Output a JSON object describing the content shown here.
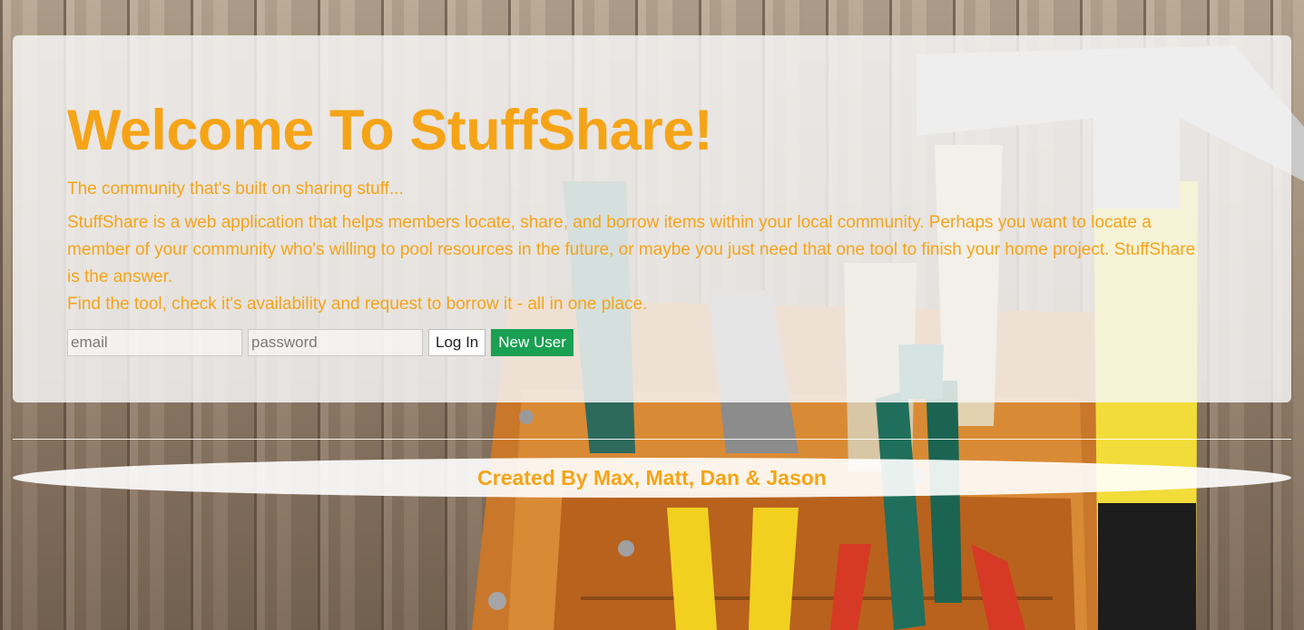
{
  "jumbotron": {
    "title": "Welcome To StuffShare!",
    "tagline": "The community that's built on sharing stuff...",
    "description": [
      "StuffShare is a web application that helps members locate, share, and borrow items within your local community. Perhaps you want to locate a member of your community who's willing to pool resources in the future, or maybe you just need that one tool to finish your home project. StuffShare is the answer.",
      "Find the tool, check it's availability and request to borrow it - all in one place."
    ]
  },
  "login": {
    "email_placeholder": "email",
    "email_value": "",
    "password_placeholder": "password",
    "password_value": "",
    "login_label": "Log In",
    "new_user_label": "New User"
  },
  "footer": {
    "credits": "Created By Max, Matt, Dan & Jason"
  },
  "theme": {
    "accent_orange": "#f5a417",
    "new_user_green": "#1aa052",
    "panel_background": "rgba(245,245,245,0.84)"
  },
  "background": {
    "image_subject": "tool belt with hammer, pliers and screwdrivers on wooden planks"
  }
}
